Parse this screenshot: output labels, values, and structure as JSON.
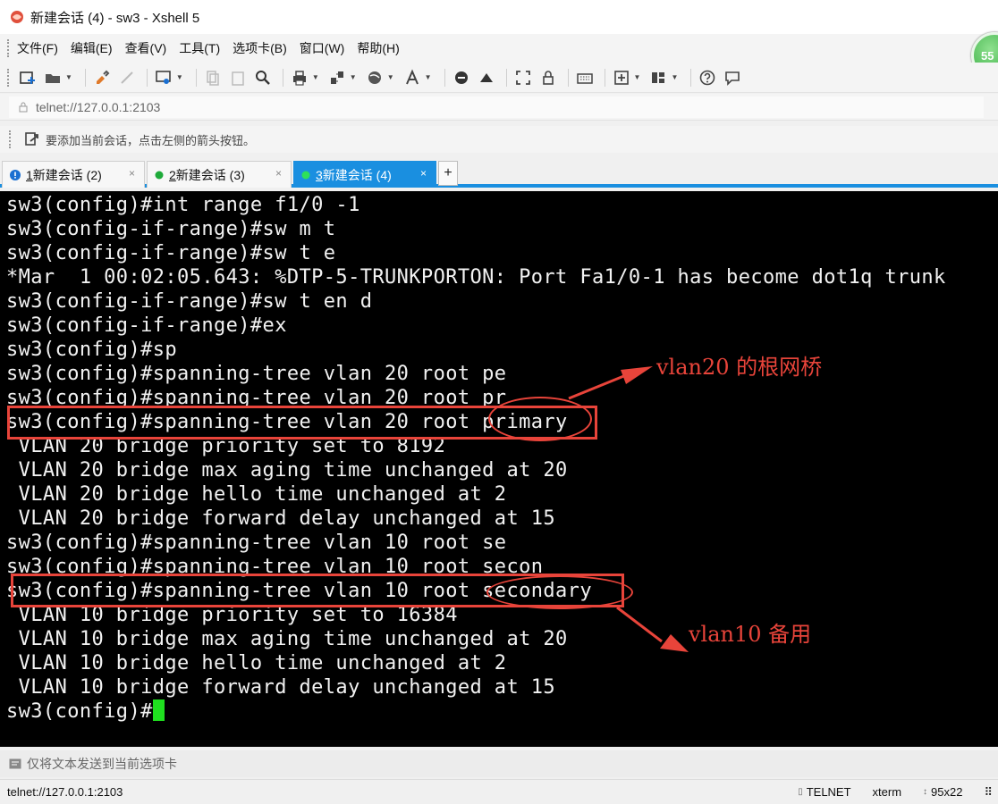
{
  "window": {
    "title": "新建会话 (4) - sw3 - Xshell 5",
    "badge": "55"
  },
  "menu": [
    "文件(F)",
    "编辑(E)",
    "查看(V)",
    "工具(T)",
    "选项卡(B)",
    "窗口(W)",
    "帮助(H)"
  ],
  "toolbar": {
    "icons": [
      "new-session-icon",
      "open-folder-icon",
      "reconnect-icon",
      "disconnect-icon",
      "properties-icon",
      "copy-icon",
      "paste-icon",
      "find-icon",
      "print-icon",
      "transfer-icon",
      "globe-icon",
      "font-icon",
      "xftp-icon",
      "xshell-icon",
      "fullscreen-icon",
      "lock-icon",
      "keyboard-icon",
      "add-tab-icon",
      "layout-icon",
      "help-icon",
      "chat-icon"
    ]
  },
  "address": {
    "value": "telnet://127.0.0.1:2103"
  },
  "hint": {
    "text": "要添加当前会话，点击左侧的箭头按钮。"
  },
  "tabs": [
    {
      "num": "1",
      "label": " 新建会话 (2)",
      "status": "warning",
      "color": "#1a6fd1",
      "active": false
    },
    {
      "num": "2",
      "label": " 新建会话 (3)",
      "status": "connected",
      "color": "#1faa3a",
      "active": false
    },
    {
      "num": "3",
      "label": " 新建会话 (4)",
      "status": "connected",
      "color": "#2ee05a",
      "active": true
    }
  ],
  "tab_add_label": "+",
  "tab_close_label": "×",
  "terminal": {
    "lines": [
      "sw3(config)#int range f1/0 -1",
      "sw3(config-if-range)#sw m t",
      "sw3(config-if-range)#sw t e",
      "*Mar  1 00:02:05.643: %DTP-5-TRUNKPORTON: Port Fa1/0-1 has become dot1q trunk",
      "sw3(config-if-range)#sw t en d",
      "sw3(config-if-range)#ex",
      "sw3(config)#sp",
      "sw3(config)#spanning-tree vlan 20 root pe",
      "sw3(config)#spanning-tree vlan 20 root pr",
      "sw3(config)#spanning-tree vlan 20 root primary",
      " VLAN 20 bridge priority set to 8192",
      " VLAN 20 bridge max aging time unchanged at 20",
      " VLAN 20 bridge hello time unchanged at 2",
      " VLAN 20 bridge forward delay unchanged at 15",
      "sw3(config)#spanning-tree vlan 10 root se",
      "sw3(config)#spanning-tree vlan 10 root secon",
      "sw3(config)#spanning-tree vlan 10 root secondary",
      " VLAN 10 bridge priority set to 16384",
      " VLAN 10 bridge max aging time unchanged at 20",
      " VLAN 10 bridge hello time unchanged at 2",
      " VLAN 10 bridge forward delay unchanged at 15",
      "sw3(config)#"
    ],
    "text_color": "#f2f2f2",
    "background": "#000000",
    "cursor_color": "#1fe01f"
  },
  "annotations": {
    "color": "#e8443a",
    "vlan20": "vlan20 的根网桥",
    "vlan10": "vlan10 备用"
  },
  "sendbar": {
    "text": "仅将文本发送到当前选项卡"
  },
  "status": {
    "address": "telnet://127.0.0.1:2103",
    "protocol": "TELNET",
    "terminal_type": "xterm",
    "size": "95x22"
  }
}
